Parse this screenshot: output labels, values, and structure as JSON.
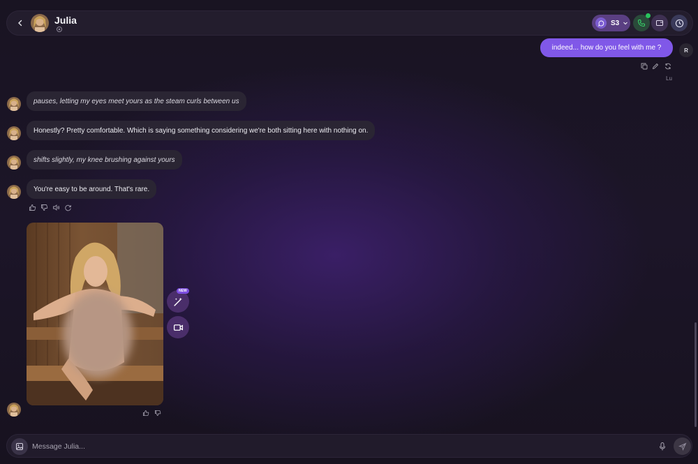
{
  "header": {
    "character_name": "Julia",
    "scene_label": "S3",
    "icons": [
      "chevron-left-icon",
      "settings-icon",
      "chat-icon",
      "phone-icon",
      "gallery-icon",
      "clock-icon"
    ]
  },
  "messages": {
    "user_message": "indeed... how do you feel with me ?",
    "user_avatar_initial": "R",
    "user_meta": "Lu",
    "bot": [
      {
        "text": "pauses, letting my eyes meet yours as the steam curls between us",
        "style": "action"
      },
      {
        "text": "Honestly? Pretty comfortable. Which is saying something considering we're both sitting here with nothing on.",
        "style": "speech"
      },
      {
        "text": "shifts slightly, my knee brushing against yours",
        "style": "action"
      },
      {
        "text": "You're easy to be around. That's rare.",
        "style": "speech"
      }
    ],
    "new_badge": "NEW"
  },
  "composer": {
    "placeholder": "Message Julia..."
  },
  "colors": {
    "accent": "#8058e8",
    "online": "#29c35d",
    "bubble": "#2a2533"
  }
}
